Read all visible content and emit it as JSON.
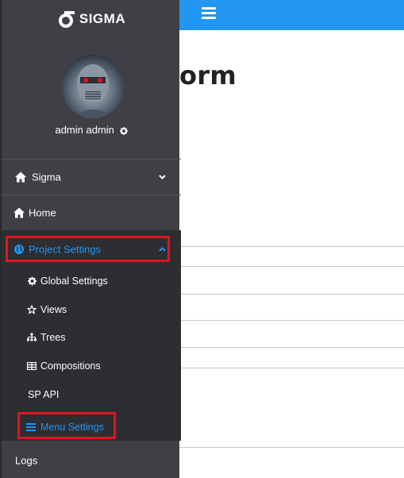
{
  "app": {
    "brand": "SIGMA"
  },
  "user": {
    "name": "admin admin"
  },
  "page": {
    "title": "orm"
  },
  "sidebar": {
    "sigma_label": "Sigma",
    "home_label": "Home",
    "project_settings_label": "Project Settings",
    "project_settings_items": [
      {
        "label": "Global Settings",
        "icon": "gear-icon"
      },
      {
        "label": "Views",
        "icon": "star-icon"
      },
      {
        "label": "Trees",
        "icon": "sitemap-icon"
      },
      {
        "label": "Compositions",
        "icon": "table-icon"
      },
      {
        "label": "SP API",
        "icon": ""
      },
      {
        "label": "Menu Settings",
        "icon": "bars-icon"
      }
    ],
    "logs_label": "Logs"
  },
  "colors": {
    "accent": "#2196f3",
    "sidebar_bg": "#3f3f45",
    "submenu_bg": "#2d2d32",
    "highlight_box": "#e0141f"
  }
}
